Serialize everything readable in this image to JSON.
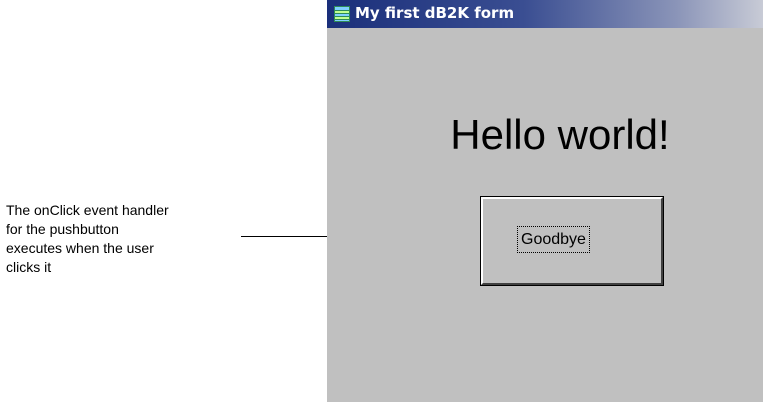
{
  "callout": {
    "lines": [
      "The onClick event handler",
      "for the pushbutton",
      "executes when the user",
      "clicks it"
    ]
  },
  "form": {
    "title": "My first dB2K form",
    "icon": "form-window-icon",
    "hello_text": "Hello world!",
    "button_label": "Goodbye"
  },
  "colors": {
    "window_background": "#c0c0c0",
    "titlebar_start": "#1a2f7a",
    "titlebar_end": "#c8cbd6",
    "title_text": "#ffffff"
  }
}
